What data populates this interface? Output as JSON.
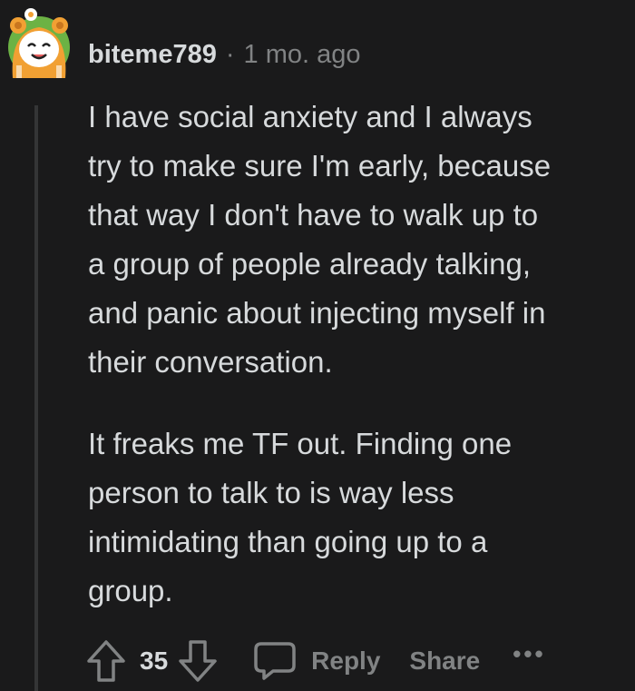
{
  "comment": {
    "username": "biteme789",
    "separator": "·",
    "timestamp": "1 mo. ago",
    "paragraphs": [
      "I have social anxiety and I always\ntry to make sure I'm early, because\nthat way I don't have to walk up to\na group of people already talking,\nand panic about injecting myself in\ntheir conversation.",
      "It freaks me TF out. Finding one\nperson to talk to is way less\nintimidating than going up to a\ngroup."
    ]
  },
  "actions": {
    "score": "35",
    "reply_label": "Reply",
    "share_label": "Share",
    "more_label": "•••"
  },
  "icons": {
    "avatar": "avatar-icon",
    "upvote": "upvote-arrow-icon",
    "downvote": "downvote-arrow-icon",
    "reply": "speech-bubble-icon",
    "more": "more-dots-icon"
  },
  "colors": {
    "background": "#1a1a1b",
    "text": "#d7dadc",
    "muted": "#818384",
    "thread_line": "#343536",
    "avatar_orange": "#f1a033",
    "avatar_green": "#6cb244"
  }
}
